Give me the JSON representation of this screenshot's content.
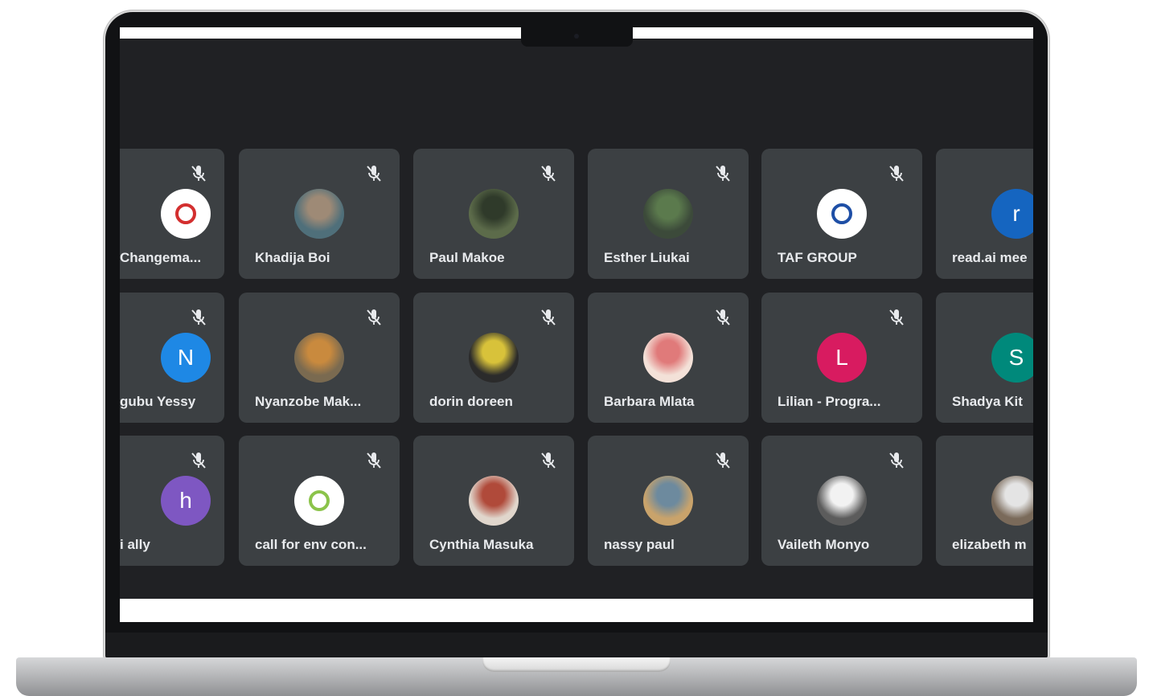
{
  "participants": [
    {
      "name": "Changema...",
      "avatar": {
        "type": "logo",
        "colors": [
          "#ffffff",
          "#d32f2f"
        ]
      },
      "muted": true
    },
    {
      "name": "Khadija Boi",
      "avatar": {
        "type": "photo",
        "colors": [
          "#9e8a76",
          "#4f6f7a"
        ]
      },
      "muted": true
    },
    {
      "name": "Paul Makoe",
      "avatar": {
        "type": "photo",
        "colors": [
          "#2f3a2a",
          "#5c6b4a"
        ]
      },
      "muted": true
    },
    {
      "name": "Esther Liukai",
      "avatar": {
        "type": "photo",
        "colors": [
          "#5b7a4d",
          "#3c4a3a"
        ]
      },
      "muted": true
    },
    {
      "name": "TAF GROUP",
      "avatar": {
        "type": "logo",
        "colors": [
          "#ffffff",
          "#1e4fa6"
        ]
      },
      "muted": true
    },
    {
      "name": "read.ai mee",
      "avatar": {
        "type": "initial",
        "initial": "r",
        "color": "#1565c0"
      },
      "muted": false
    },
    {
      "name": "gubu Yessy",
      "avatar": {
        "type": "initial",
        "initial": "N",
        "color": "#1e88e5"
      },
      "muted": true
    },
    {
      "name": "Nyanzobe Mak...",
      "avatar": {
        "type": "photo",
        "colors": [
          "#c98a3e",
          "#7a6a50"
        ]
      },
      "muted": true
    },
    {
      "name": "dorin doreen",
      "avatar": {
        "type": "photo",
        "colors": [
          "#d8c23a",
          "#2b2b2b"
        ]
      },
      "muted": true
    },
    {
      "name": "Barbara Mlata",
      "avatar": {
        "type": "photo",
        "colors": [
          "#e07a7a",
          "#f3e1d8"
        ]
      },
      "muted": true
    },
    {
      "name": "Lilian - Progra...",
      "avatar": {
        "type": "initial",
        "initial": "L",
        "color": "#d81b60"
      },
      "muted": true
    },
    {
      "name": "Shadya Kit",
      "avatar": {
        "type": "initial",
        "initial": "S",
        "color": "#00897b"
      },
      "muted": false
    },
    {
      "name": "i ally",
      "avatar": {
        "type": "initial",
        "initial": "h",
        "color": "#7e57c2"
      },
      "muted": true
    },
    {
      "name": "call for env con...",
      "avatar": {
        "type": "logo",
        "colors": [
          "#ffffff",
          "#8bc34a"
        ]
      },
      "muted": true
    },
    {
      "name": "Cynthia Masuka",
      "avatar": {
        "type": "photo",
        "colors": [
          "#b04a3a",
          "#e0d6cc"
        ]
      },
      "muted": true
    },
    {
      "name": "nassy paul",
      "avatar": {
        "type": "photo",
        "colors": [
          "#6d8a9e",
          "#c9a36b"
        ]
      },
      "muted": true
    },
    {
      "name": "Vaileth Monyo",
      "avatar": {
        "type": "photo",
        "colors": [
          "#f2f2f2",
          "#5c5c5c"
        ]
      },
      "muted": true
    },
    {
      "name": "elizabeth m",
      "avatar": {
        "type": "photo",
        "colors": [
          "#e4e4e4",
          "#7a6a5a"
        ]
      },
      "muted": false
    }
  ],
  "colors": {
    "screen_bg": "#202124",
    "tile_bg": "#3c4043",
    "name_text": "#e8eaed",
    "icon": "#e8eaed"
  }
}
